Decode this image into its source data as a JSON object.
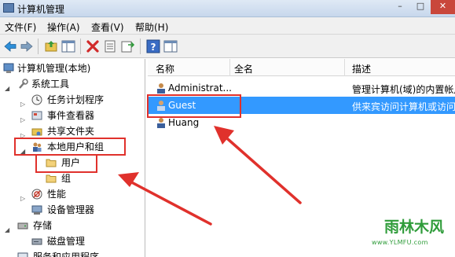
{
  "window": {
    "title": "计算机管理",
    "minimize_glyph": "–",
    "maximize_glyph": "□",
    "close_glyph": "✕"
  },
  "menu": [
    {
      "label": "文件(F)"
    },
    {
      "label": "操作(A)"
    },
    {
      "label": "查看(V)"
    },
    {
      "label": "帮助(H)"
    }
  ],
  "toolbar": {
    "icons": [
      "back-icon",
      "forward-icon",
      "up-folder-icon",
      "show-tree-icon",
      "delete-icon",
      "properties-icon",
      "export-icon",
      "help-icon",
      "action-pane-icon"
    ]
  },
  "tree": {
    "items": [
      {
        "label": "计算机管理(本地)",
        "icon": "computer-management-icon",
        "expander": ""
      },
      {
        "label": "系统工具",
        "icon": "tools-icon",
        "expander": "◢"
      },
      {
        "label": "任务计划程序",
        "icon": "clock-icon",
        "expander": "▷"
      },
      {
        "label": "事件查看器",
        "icon": "event-viewer-icon",
        "expander": "▷"
      },
      {
        "label": "共享文件夹",
        "icon": "shared-folder-icon",
        "expander": "▷"
      },
      {
        "label": "本地用户和组",
        "icon": "users-groups-icon",
        "expander": "◢"
      },
      {
        "label": "用户",
        "icon": "folder-icon",
        "expander": ""
      },
      {
        "label": "组",
        "icon": "folder-icon",
        "expander": ""
      },
      {
        "label": "性能",
        "icon": "performance-icon",
        "expander": "▷"
      },
      {
        "label": "设备管理器",
        "icon": "device-manager-icon",
        "expander": ""
      },
      {
        "label": "存储",
        "icon": "storage-icon",
        "expander": "◢"
      },
      {
        "label": "磁盘管理",
        "icon": "disk-icon",
        "expander": ""
      },
      {
        "label": "服务和应用程序",
        "icon": "services-icon",
        "expander": "▷"
      }
    ]
  },
  "list": {
    "columns": [
      "名称",
      "全名",
      "描述"
    ],
    "rows": [
      {
        "name": "Administrat...",
        "fullname": "",
        "description": "管理计算机(域)的内置帐户",
        "selected": false
      },
      {
        "name": "Guest",
        "fullname": "",
        "description": "供来宾访问计算机或访问",
        "selected": true
      },
      {
        "name": "Huang",
        "fullname": "",
        "description": "",
        "selected": false
      }
    ]
  },
  "annotation_color": "#e0312c",
  "selection_color": "#3399ff",
  "watermark": {
    "title": "雨林木风",
    "url": "www.YLMFU.com"
  }
}
